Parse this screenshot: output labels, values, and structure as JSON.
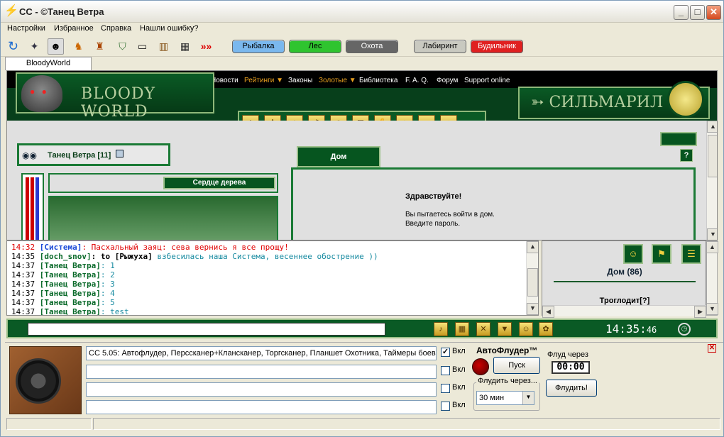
{
  "window": {
    "title": "CC - ©Танец Ветра",
    "app_icon": "lightning-icon"
  },
  "menu": [
    "Настройки",
    "Избранное",
    "Справка",
    "Нашли ошибку?"
  ],
  "toolbar": {
    "pills": [
      {
        "label": "Рыбалка",
        "color": "#7ab8ee"
      },
      {
        "label": "Лес",
        "color": "#2fc42f"
      },
      {
        "label": "Охота",
        "color": "#666666"
      },
      {
        "label": "Лабиринт",
        "color": "#c9c9c0"
      },
      {
        "label": "Будильник",
        "color": "#e02020"
      }
    ]
  },
  "tab": {
    "label": "BloodyWorld"
  },
  "game": {
    "nav": [
      "Новости",
      "Рейтинги ▼",
      "Законы",
      "Золотые ▼",
      "Библиотека",
      "F. A. Q.",
      "Форум",
      "Support online"
    ],
    "logo_text": "BLOODY WORLD",
    "silmaril_text": "СИЛЬМАРИЛ",
    "character": "Танец Ветра [11]",
    "heart_button": "Сердце дерева",
    "house_tab": "Дом",
    "greeting": "Здравствуйте!",
    "message_line1": "Вы пытаетесь войти в дом.",
    "message_line2": "Введите пароль.",
    "help": "?"
  },
  "chat": [
    {
      "time": "14:32",
      "who": "[Система]",
      "to": "",
      "text": ": Пасхальный заяц: сева вернись я все прощу!",
      "kind": "system"
    },
    {
      "time": "14:35",
      "who": "[doch_snov]",
      "to": ": to [Рыжуха]",
      "text": " взбесилась наша Система, весеннее обострение ))",
      "kind": "teal"
    },
    {
      "time": "14:37",
      "who": "[Танец Ветра]",
      "to": "",
      "text": ": 1",
      "kind": "teal"
    },
    {
      "time": "14:37",
      "who": "[Танец Ветра]",
      "to": "",
      "text": ": 2",
      "kind": "teal"
    },
    {
      "time": "14:37",
      "who": "[Танец Ветра]",
      "to": "",
      "text": ": 3",
      "kind": "teal"
    },
    {
      "time": "14:37",
      "who": "[Танец Ветра]",
      "to": "",
      "text": ": 4",
      "kind": "teal"
    },
    {
      "time": "14:37",
      "who": "[Танец Ветра]",
      "to": "",
      "text": ": 5",
      "kind": "teal"
    },
    {
      "time": "14:37",
      "who": "[Танец Ветра]",
      "to": "",
      "text": ": test",
      "kind": "teal"
    }
  ],
  "right": {
    "title": "Дом (86)",
    "player": "Троглодит[?]"
  },
  "clock": {
    "hm": "14:35:",
    "sec": "46"
  },
  "flooder": {
    "lines": [
      "CC 5.05: Автофлудер, Персcканер+Кланcканер, Торгсканер, Планшет Охотника, Таймеры боев",
      "",
      "",
      ""
    ],
    "checks": [
      true,
      false,
      false,
      false
    ],
    "check_label": "Вкл",
    "title": "АвтоФлудер™",
    "start": "Пуск",
    "every_label": "Флудить через...",
    "every_value": "30 мин",
    "after_label": "Флуд через",
    "timer": "00:00",
    "flood_btn": "Флудить!"
  }
}
